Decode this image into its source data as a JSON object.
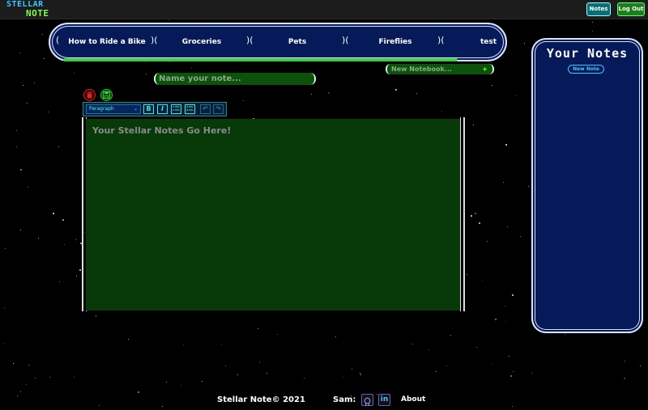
{
  "header": {
    "logo_line1": "STELLAR",
    "logo_line2": "NOTE",
    "notes_button": "Notes",
    "logout_button": "Log Out"
  },
  "tabs": [
    {
      "label": "How to Ride a Bike"
    },
    {
      "label": "Groceries"
    },
    {
      "label": "Pets"
    },
    {
      "label": "Fireflies"
    },
    {
      "label": "test"
    }
  ],
  "note_name": {
    "placeholder": "Name your note..."
  },
  "notebook": {
    "selected": "New Notebook...",
    "plus": "+"
  },
  "toolbar": {
    "block_format": "Paragraph",
    "chevron": "⌄",
    "bold": "B",
    "italic": "I",
    "undo": "↶",
    "redo": "↷"
  },
  "editor": {
    "placeholder": "Your Stellar Notes Go Here!"
  },
  "sidebar": {
    "title": "Your Notes",
    "new_note_button": "New Note"
  },
  "footer": {
    "copyright": "Stellar Note© 2021",
    "author_label": "Sam:",
    "linkedin_glyph": "in",
    "about_link": "About"
  },
  "colors": {
    "accent_green": "#3ecb46",
    "panel_navy": "#061a5a",
    "editor_green": "#073a08",
    "accent_cyan": "#3ec6ff"
  },
  "icons": [
    "trash-icon",
    "save-icon",
    "bulleted-list-icon",
    "numbered-list-icon",
    "undo-icon",
    "redo-icon",
    "github-icon",
    "linkedin-icon"
  ]
}
